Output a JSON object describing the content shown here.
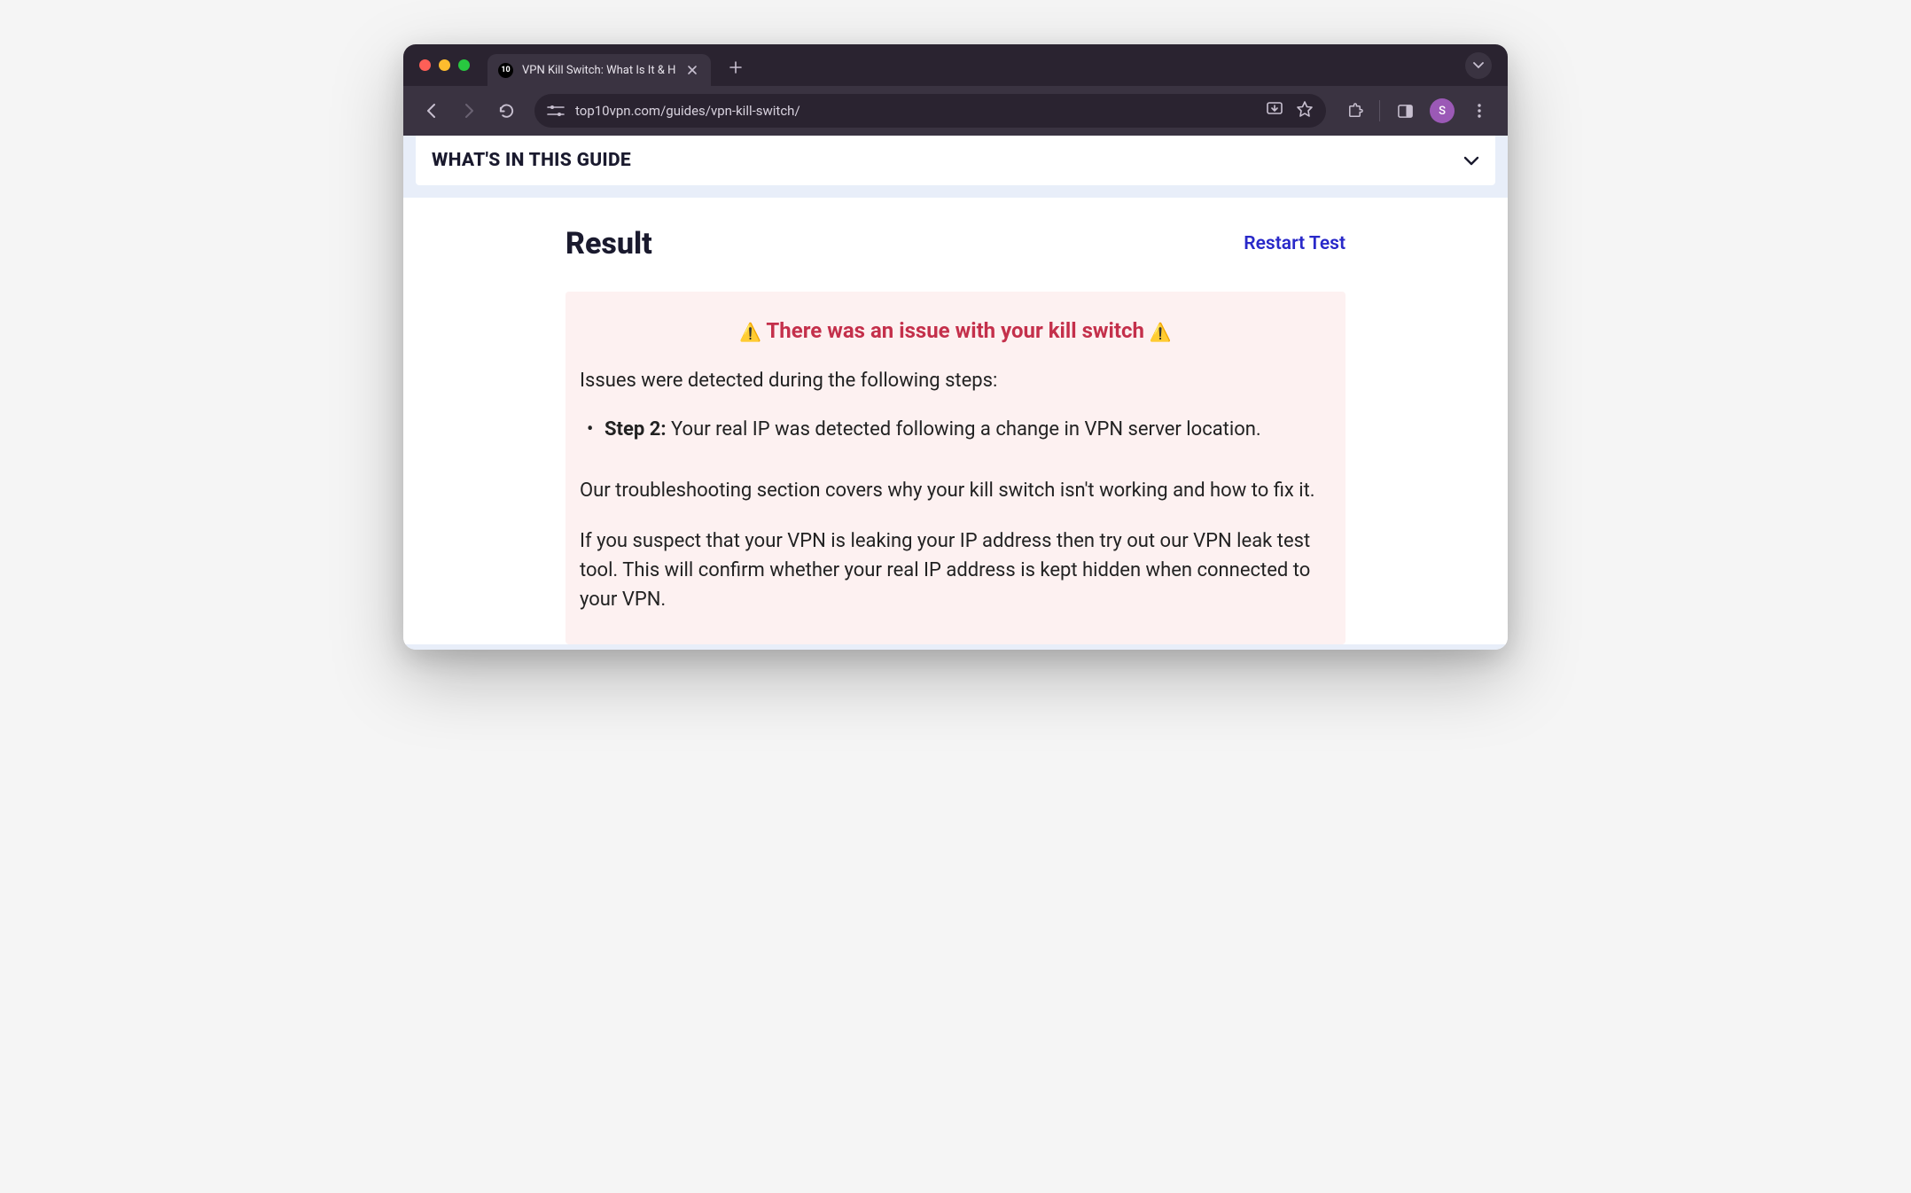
{
  "browser": {
    "tab": {
      "favicon_text": "10",
      "title": "VPN Kill Switch: What Is It & H"
    },
    "url": "top10vpn.com/guides/vpn-kill-switch/",
    "profile_initial": "S"
  },
  "toc": {
    "label": "WHAT'S IN THIS GUIDE"
  },
  "result": {
    "heading": "Result",
    "restart_label": "Restart Test",
    "alert_text": "There was an issue with your kill switch",
    "issues_intro": "Issues were detected during the following steps:",
    "issue": {
      "step_label": "Step 2:",
      "text": " Your real IP was detected following a change in VPN server location."
    },
    "para1": "Our troubleshooting section covers why your kill switch isn't working and how to fix it.",
    "para2": "If you suspect that your VPN is leaking your IP address then try out our VPN leak test tool. This will confirm whether your real IP address is kept hidden when connected to your VPN."
  }
}
